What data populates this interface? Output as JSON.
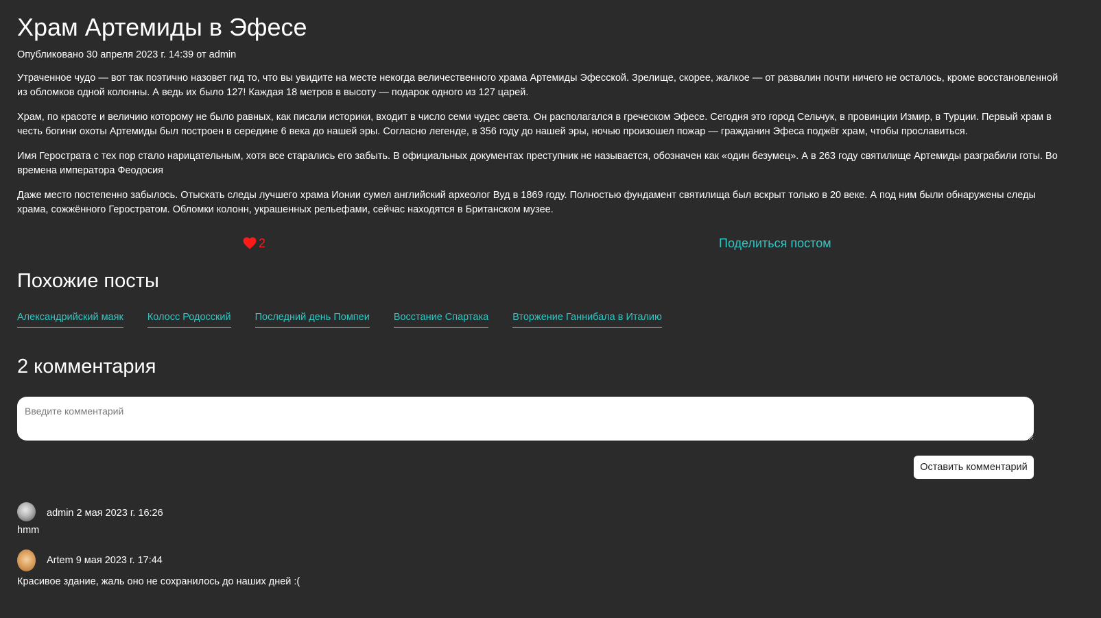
{
  "post": {
    "title": "Храм Артемиды в Эфесе",
    "meta": "Опубликовано 30 апреля 2023 г. 14:39 от admin",
    "paragraphs": [
      "Утраченное чудо — вот так поэтично назовет гид то, что вы увидите на месте некогда величественного храма Артемиды Эфесской. Зрелище, скорее, жалкое — от развалин почти ничего не осталось, кроме восстановленной из обломков одной колонны. А ведь их было 127! Каждая 18 метров в высоту — подарок одного из 127 царей.",
      "Храм, по красоте и величию которому не было равных, как писали историки, входит в число семи чудес света. Он располагался в греческом Эфесе. Сегодня это город Сельчук, в провинции Измир, в Турции. Первый храм в честь богини охоты Артемиды был построен в середине 6 века до нашей эры. Согласно легенде, в 356 году до нашей эры, ночью произошел пожар — гражданин Эфеса поджёг храм, чтобы прославиться.",
      "Имя Герострата с тех пор стало нарицательным, хотя все старались его забыть. В официальных документах преступник не называется, обозначен как «один безумец». А в 263 году святилище Артемиды разграбили готы. Во времена императора Феодосия",
      "Даже место постепенно забылось. Отыскать следы лучшего храма Ионии сумел английский археолог Вуд в 1869 году. Полностью фундамент святилища был вскрыт только в 20 веке. А под ним были обнаружены следы храма, сожжённого Геростратом. Обломки колонн, украшенных рельефами, сейчас находятся в Британском музее."
    ],
    "likes": "2",
    "like_icon": "heart-icon",
    "share_label": "Поделиться постом"
  },
  "similar": {
    "title": "Похожие посты",
    "items": [
      "Александрийский маяк",
      "Колосс Родосский",
      "Последний день Помпеи",
      "Восстание Спартака",
      "Вторжение Ганнибала в Италию"
    ]
  },
  "comments": {
    "title": "2 комментария",
    "input_placeholder": "Введите комментарий",
    "submit_label": "Оставить комментарий",
    "items": [
      {
        "author": "admin",
        "date": "2 мая 2023 г. 16:26",
        "header": "admin 2 мая 2023 г. 16:26",
        "text": "hmm"
      },
      {
        "author": "Artem",
        "date": "9 мая 2023 г. 17:44",
        "header": "Artem 9 мая 2023 г. 17:44",
        "text": "Красивое здание, жаль оно не сохранилось до наших дней :("
      }
    ]
  },
  "colors": {
    "background": "#2b2b2b",
    "text": "#ffffff",
    "link": "#2fc7c4",
    "like": "#ff1a1a"
  }
}
